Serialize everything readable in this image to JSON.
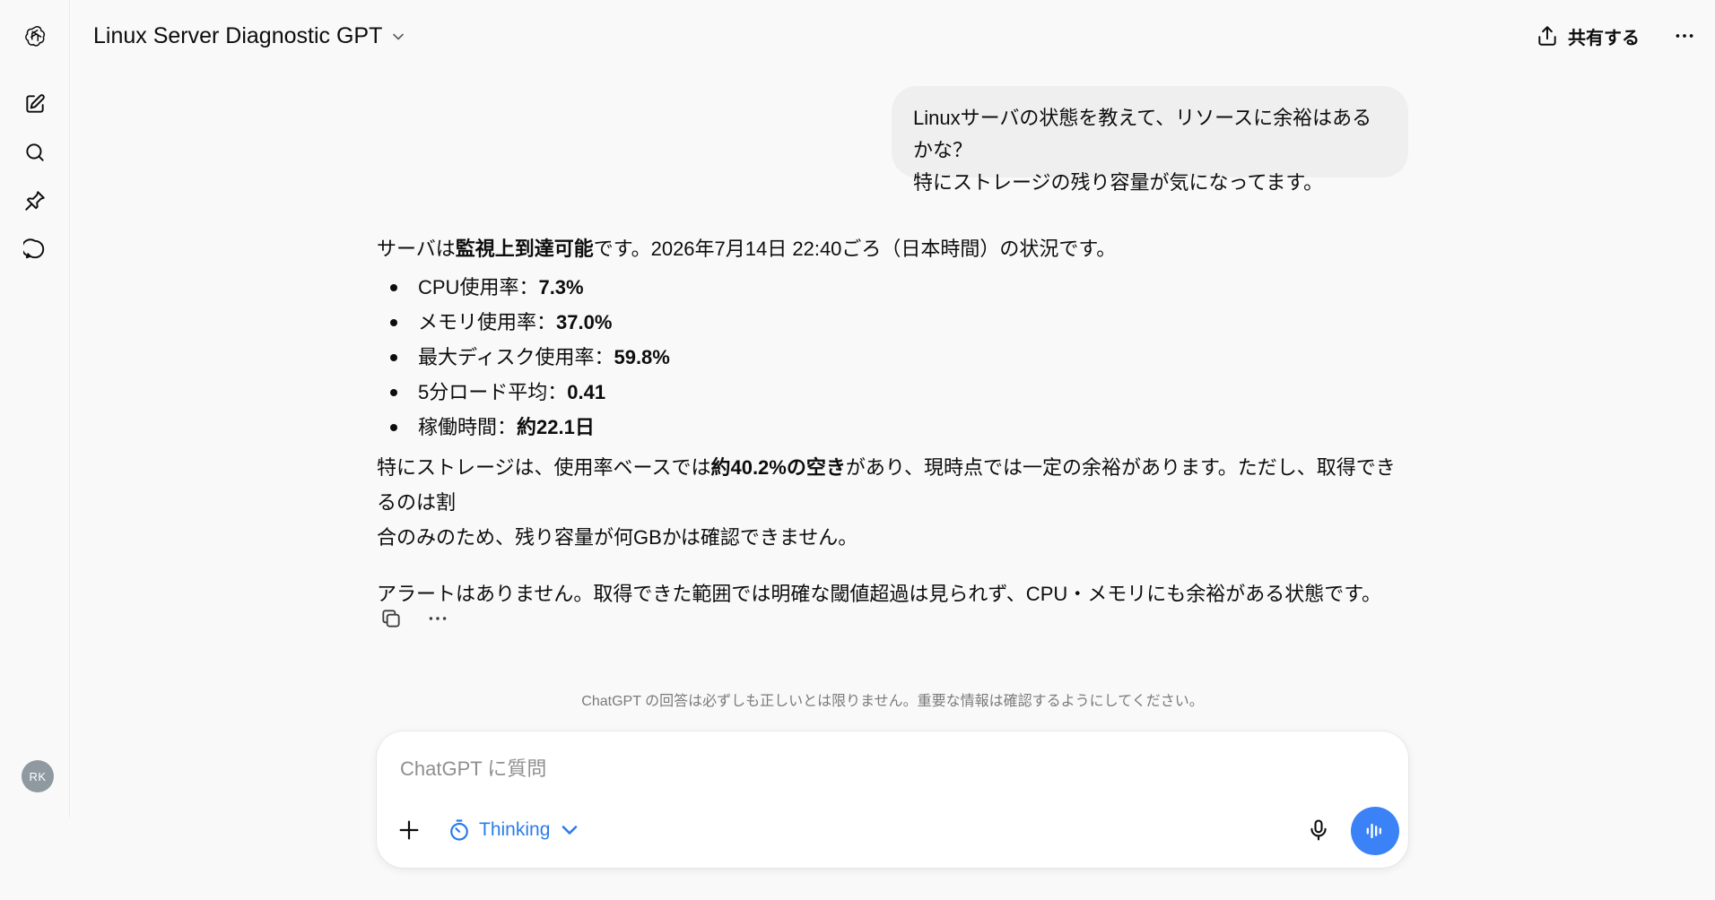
{
  "colors": {
    "background": "#f9f9f9",
    "bubble": "#efefef",
    "accent": "#2b7de9",
    "voice_button": "#3b82f6",
    "avatar": "#8e9aa0"
  },
  "sidebar": {
    "logo_icon": "openai-logo-icon",
    "items": [
      {
        "icon": "new-chat-icon"
      },
      {
        "icon": "search-icon"
      },
      {
        "icon": "pin-icon"
      },
      {
        "icon": "chat-bubble-icon"
      }
    ],
    "avatar_initials": "RK"
  },
  "header": {
    "title": "Linux Server Diagnostic GPT",
    "share_label": "共有する"
  },
  "user_message": {
    "line1": "Linuxサーバの状態を教えて、リソースに余裕はあるかな？",
    "line2": "特にストレージの残り容量が気になってます。"
  },
  "assistant_message": {
    "intro_pre": "サーバは",
    "intro_bold": "監視上到達可能",
    "intro_post": "です。2026年7月14日 22:40ごろ（日本時間）の状況です。",
    "metrics": [
      {
        "label": "CPU使用率：",
        "value": "7.3%"
      },
      {
        "label": "メモリ使用率：",
        "value": "37.0%"
      },
      {
        "label": "最大ディスク使用率：",
        "value": "59.8%"
      },
      {
        "label": "5分ロード平均：",
        "value": "0.41"
      },
      {
        "label": "稼働時間：",
        "value": "約22.1日"
      }
    ],
    "storage_pre": "特にストレージは、使用率ベースでは",
    "storage_bold": "約40.2%の空き",
    "storage_post_line1": "があり、現時点では一定の余裕があります。ただし、取得できるのは割",
    "storage_post_line2": "合のみのため、残り容量が何GBかは確認できません。",
    "alert_text": "アラートはありません。取得できた範囲では明確な閾値超過は見られず、CPU・メモリにも余裕がある状態です。"
  },
  "disclaimer": "ChatGPT の回答は必ずしも正しいとは限りません。重要な情報は確認するようにしてください。",
  "composer": {
    "placeholder": "ChatGPT に質問",
    "value": "",
    "thinking_label": "Thinking"
  }
}
